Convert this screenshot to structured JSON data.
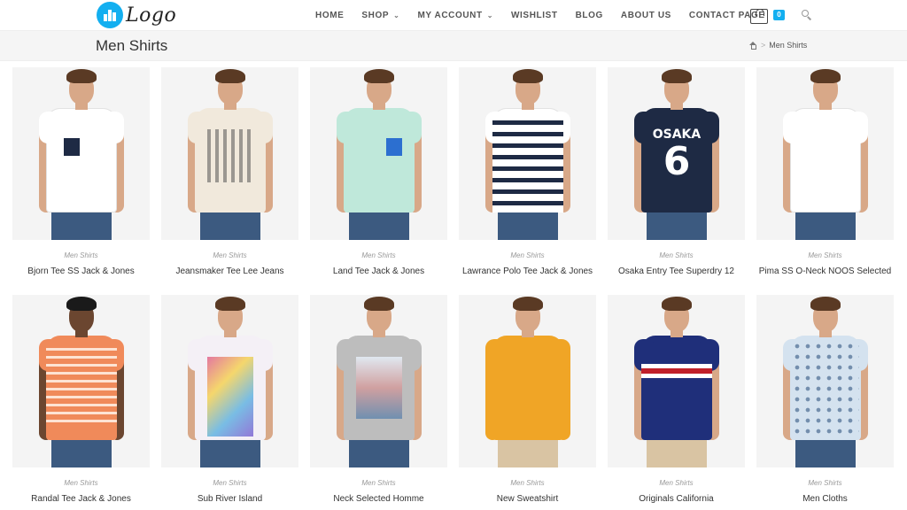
{
  "header": {
    "logo_text": "Logo",
    "nav": [
      {
        "label": "HOME",
        "has_dropdown": false
      },
      {
        "label": "SHOP",
        "has_dropdown": true
      },
      {
        "label": "MY ACCOUNT",
        "has_dropdown": true
      },
      {
        "label": "WISHLIST",
        "has_dropdown": false
      },
      {
        "label": "BLOG",
        "has_dropdown": false
      },
      {
        "label": "ABOUT US",
        "has_dropdown": false
      },
      {
        "label": "CONTACT PAGE",
        "has_dropdown": false
      }
    ],
    "cart_count": "0",
    "accent_color": "#13aff0"
  },
  "titlebar": {
    "title": "Men Shirts",
    "breadcrumb_current": "Men Shirts",
    "breadcrumb_separator": ">"
  },
  "products": [
    {
      "category": "Men Shirts",
      "name": "Bjorn Tee SS Jack & Jones",
      "shirt_color": "#ffffff",
      "sleeve": "short",
      "print": "pocket-navy"
    },
    {
      "category": "Men Shirts",
      "name": "Jeansmaker Tee Lee Jeans",
      "shirt_color": "#f1e9dc",
      "sleeve": "short",
      "print": "graphic-grid"
    },
    {
      "category": "Men Shirts",
      "name": "Land Tee Jack & Jones",
      "shirt_color": "#bfe8da",
      "sleeve": "short",
      "print": "pocket-blue"
    },
    {
      "category": "Men Shirts",
      "name": "Lawrance Polo Tee Jack & Jones",
      "shirt_color": "#ffffff",
      "sleeve": "short",
      "print": "stripes-navy"
    },
    {
      "category": "Men Shirts",
      "name": "Osaka Entry Tee Superdry 12",
      "shirt_color": "#1e2a44",
      "sleeve": "short",
      "print": "osaka-6"
    },
    {
      "category": "Men Shirts",
      "name": "Pima SS O-Neck NOOS Selected",
      "shirt_color": "#ffffff",
      "sleeve": "short",
      "print": "none"
    },
    {
      "category": "Men Shirts",
      "name": "Randal Tee Jack & Jones",
      "shirt_color": "#f08a5a",
      "sleeve": "short",
      "print": "stripes-white"
    },
    {
      "category": "Men Shirts",
      "name": "Sub River Island",
      "shirt_color": "#f4f0f6",
      "sleeve": "short",
      "print": "graphic-colorful"
    },
    {
      "category": "Men Shirts",
      "name": "Neck Selected Homme",
      "shirt_color": "#bdbdbd",
      "sleeve": "short",
      "print": "graphic-photo"
    },
    {
      "category": "Men Shirts",
      "name": "New Sweatshirt",
      "shirt_color": "#f0a526",
      "sleeve": "long",
      "print": "none"
    },
    {
      "category": "Men Shirts",
      "name": "Originals California",
      "shirt_color": "#1f2f7a",
      "sleeve": "short",
      "print": "band-red"
    },
    {
      "category": "Men Shirts",
      "name": "Men Cloths",
      "shirt_color": "#d4e2ef",
      "sleeve": "short",
      "print": "floral"
    }
  ],
  "page_title_osaka_text": "OSAKA",
  "page_title_osaka_number": "6"
}
